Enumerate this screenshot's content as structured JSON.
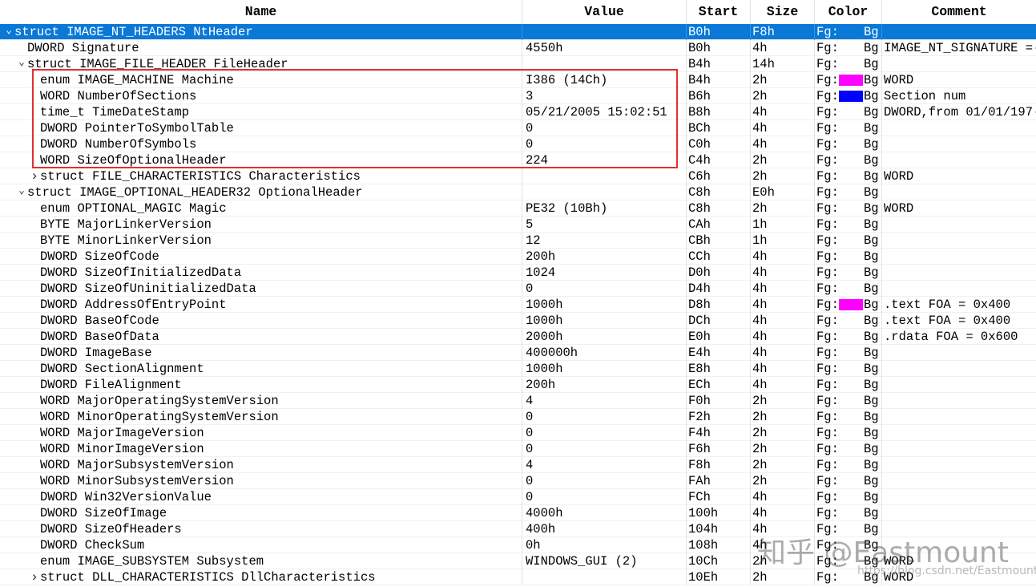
{
  "columns": [
    "Name",
    "Value",
    "Start",
    "Size",
    "Color",
    "Comment"
  ],
  "rows": [
    {
      "name": "struct IMAGE_NT_HEADERS NtHeader",
      "indent": 0,
      "toggle": "expanded",
      "value": "",
      "start": "B0h",
      "size": "F8h",
      "fg": "Fg:",
      "bg": "Bg",
      "swatch": "",
      "comment": "",
      "selected": true
    },
    {
      "name": "DWORD Signature",
      "indent": 1,
      "toggle": "",
      "value": "4550h",
      "start": "B0h",
      "size": "4h",
      "fg": "Fg:",
      "bg": "Bg",
      "swatch": "",
      "comment": "IMAGE_NT_SIGNATURE =·"
    },
    {
      "name": "struct IMAGE_FILE_HEADER FileHeader",
      "indent": 1,
      "toggle": "expanded",
      "value": "",
      "start": "B4h",
      "size": "14h",
      "fg": "Fg:",
      "bg": "Bg",
      "swatch": "",
      "comment": ""
    },
    {
      "name": "enum IMAGE_MACHINE Machine",
      "indent": 2,
      "toggle": "",
      "value": "I386 (14Ch)",
      "start": "B4h",
      "size": "2h",
      "fg": "Fg:",
      "bg": "Bg",
      "swatch": "#ff00ff",
      "comment": "WORD"
    },
    {
      "name": "WORD NumberOfSections",
      "indent": 2,
      "toggle": "",
      "value": "3",
      "start": "B6h",
      "size": "2h",
      "fg": "Fg:",
      "bg": "Bg",
      "swatch": "#0000ff",
      "comment": "Section num"
    },
    {
      "name": "time_t TimeDateStamp",
      "indent": 2,
      "toggle": "",
      "value": "05/21/2005 15:02:51",
      "start": "B8h",
      "size": "4h",
      "fg": "Fg:",
      "bg": "Bg",
      "swatch": "",
      "comment": "DWORD,from 01/01/197·"
    },
    {
      "name": "DWORD PointerToSymbolTable",
      "indent": 2,
      "toggle": "",
      "value": "0",
      "start": "BCh",
      "size": "4h",
      "fg": "Fg:",
      "bg": "Bg",
      "swatch": "",
      "comment": ""
    },
    {
      "name": "DWORD NumberOfSymbols",
      "indent": 2,
      "toggle": "",
      "value": "0",
      "start": "C0h",
      "size": "4h",
      "fg": "Fg:",
      "bg": "Bg",
      "swatch": "",
      "comment": ""
    },
    {
      "name": "WORD SizeOfOptionalHeader",
      "indent": 2,
      "toggle": "",
      "value": "224",
      "start": "C4h",
      "size": "2h",
      "fg": "Fg:",
      "bg": "Bg",
      "swatch": "",
      "comment": ""
    },
    {
      "name": "struct FILE_CHARACTERISTICS Characteristics",
      "indent": 2,
      "toggle": "collapsed",
      "value": "",
      "start": "C6h",
      "size": "2h",
      "fg": "Fg:",
      "bg": "Bg",
      "swatch": "",
      "comment": "WORD"
    },
    {
      "name": "struct IMAGE_OPTIONAL_HEADER32 OptionalHeader",
      "indent": 1,
      "toggle": "expanded",
      "value": "",
      "start": "C8h",
      "size": "E0h",
      "fg": "Fg:",
      "bg": "Bg",
      "swatch": "",
      "comment": ""
    },
    {
      "name": "enum OPTIONAL_MAGIC Magic",
      "indent": 2,
      "toggle": "",
      "value": "PE32 (10Bh)",
      "start": "C8h",
      "size": "2h",
      "fg": "Fg:",
      "bg": "Bg",
      "swatch": "",
      "comment": "WORD"
    },
    {
      "name": "BYTE MajorLinkerVersion",
      "indent": 2,
      "toggle": "",
      "value": "5",
      "start": "CAh",
      "size": "1h",
      "fg": "Fg:",
      "bg": "Bg",
      "swatch": "",
      "comment": ""
    },
    {
      "name": "BYTE MinorLinkerVersion",
      "indent": 2,
      "toggle": "",
      "value": "12",
      "start": "CBh",
      "size": "1h",
      "fg": "Fg:",
      "bg": "Bg",
      "swatch": "",
      "comment": ""
    },
    {
      "name": "DWORD SizeOfCode",
      "indent": 2,
      "toggle": "",
      "value": "200h",
      "start": "CCh",
      "size": "4h",
      "fg": "Fg:",
      "bg": "Bg",
      "swatch": "",
      "comment": ""
    },
    {
      "name": "DWORD SizeOfInitializedData",
      "indent": 2,
      "toggle": "",
      "value": "1024",
      "start": "D0h",
      "size": "4h",
      "fg": "Fg:",
      "bg": "Bg",
      "swatch": "",
      "comment": ""
    },
    {
      "name": "DWORD SizeOfUninitializedData",
      "indent": 2,
      "toggle": "",
      "value": "0",
      "start": "D4h",
      "size": "4h",
      "fg": "Fg:",
      "bg": "Bg",
      "swatch": "",
      "comment": ""
    },
    {
      "name": "DWORD AddressOfEntryPoint",
      "indent": 2,
      "toggle": "",
      "value": "1000h",
      "start": "D8h",
      "size": "4h",
      "fg": "Fg:",
      "bg": "Bg",
      "swatch": "#ff00ff",
      "comment": ".text FOA = 0x400"
    },
    {
      "name": "DWORD BaseOfCode",
      "indent": 2,
      "toggle": "",
      "value": "1000h",
      "start": "DCh",
      "size": "4h",
      "fg": "Fg:",
      "bg": "Bg",
      "swatch": "",
      "comment": ".text FOA = 0x400"
    },
    {
      "name": "DWORD BaseOfData",
      "indent": 2,
      "toggle": "",
      "value": "2000h",
      "start": "E0h",
      "size": "4h",
      "fg": "Fg:",
      "bg": "Bg",
      "swatch": "",
      "comment": ".rdata FOA = 0x600"
    },
    {
      "name": "DWORD ImageBase",
      "indent": 2,
      "toggle": "",
      "value": "400000h",
      "start": "E4h",
      "size": "4h",
      "fg": "Fg:",
      "bg": "Bg",
      "swatch": "",
      "comment": ""
    },
    {
      "name": "DWORD SectionAlignment",
      "indent": 2,
      "toggle": "",
      "value": "1000h",
      "start": "E8h",
      "size": "4h",
      "fg": "Fg:",
      "bg": "Bg",
      "swatch": "",
      "comment": ""
    },
    {
      "name": "DWORD FileAlignment",
      "indent": 2,
      "toggle": "",
      "value": "200h",
      "start": "ECh",
      "size": "4h",
      "fg": "Fg:",
      "bg": "Bg",
      "swatch": "",
      "comment": ""
    },
    {
      "name": "WORD MajorOperatingSystemVersion",
      "indent": 2,
      "toggle": "",
      "value": "4",
      "start": "F0h",
      "size": "2h",
      "fg": "Fg:",
      "bg": "Bg",
      "swatch": "",
      "comment": ""
    },
    {
      "name": "WORD MinorOperatingSystemVersion",
      "indent": 2,
      "toggle": "",
      "value": "0",
      "start": "F2h",
      "size": "2h",
      "fg": "Fg:",
      "bg": "Bg",
      "swatch": "",
      "comment": ""
    },
    {
      "name": "WORD MajorImageVersion",
      "indent": 2,
      "toggle": "",
      "value": "0",
      "start": "F4h",
      "size": "2h",
      "fg": "Fg:",
      "bg": "Bg",
      "swatch": "",
      "comment": ""
    },
    {
      "name": "WORD MinorImageVersion",
      "indent": 2,
      "toggle": "",
      "value": "0",
      "start": "F6h",
      "size": "2h",
      "fg": "Fg:",
      "bg": "Bg",
      "swatch": "",
      "comment": ""
    },
    {
      "name": "WORD MajorSubsystemVersion",
      "indent": 2,
      "toggle": "",
      "value": "4",
      "start": "F8h",
      "size": "2h",
      "fg": "Fg:",
      "bg": "Bg",
      "swatch": "",
      "comment": ""
    },
    {
      "name": "WORD MinorSubsystemVersion",
      "indent": 2,
      "toggle": "",
      "value": "0",
      "start": "FAh",
      "size": "2h",
      "fg": "Fg:",
      "bg": "Bg",
      "swatch": "",
      "comment": ""
    },
    {
      "name": "DWORD Win32VersionValue",
      "indent": 2,
      "toggle": "",
      "value": "0",
      "start": "FCh",
      "size": "4h",
      "fg": "Fg:",
      "bg": "Bg",
      "swatch": "",
      "comment": ""
    },
    {
      "name": "DWORD SizeOfImage",
      "indent": 2,
      "toggle": "",
      "value": "4000h",
      "start": "100h",
      "size": "4h",
      "fg": "Fg:",
      "bg": "Bg",
      "swatch": "",
      "comment": ""
    },
    {
      "name": "DWORD SizeOfHeaders",
      "indent": 2,
      "toggle": "",
      "value": "400h",
      "start": "104h",
      "size": "4h",
      "fg": "Fg:",
      "bg": "Bg",
      "swatch": "",
      "comment": ""
    },
    {
      "name": "DWORD CheckSum",
      "indent": 2,
      "toggle": "",
      "value": "0h",
      "start": "108h",
      "size": "4h",
      "fg": "Fg:",
      "bg": "Bg",
      "swatch": "",
      "comment": ""
    },
    {
      "name": "enum IMAGE_SUBSYSTEM Subsystem",
      "indent": 2,
      "toggle": "",
      "value": "WINDOWS_GUI (2)",
      "start": "10Ch",
      "size": "2h",
      "fg": "Fg:",
      "bg": "Bg",
      "swatch": "",
      "comment": "WORD"
    },
    {
      "name": "struct DLL_CHARACTERISTICS DllCharacteristics",
      "indent": 2,
      "toggle": "collapsed",
      "value": "",
      "start": "10Eh",
      "size": "2h",
      "fg": "Fg:",
      "bg": "Bg",
      "swatch": "",
      "comment": "WORD"
    }
  ],
  "watermark": {
    "main": "知乎 @Eastmount",
    "url": "https://blog.csdn.net/Eastmount"
  },
  "colors": {
    "selection": "#0a78d7",
    "highlight_box": "#e03030"
  }
}
